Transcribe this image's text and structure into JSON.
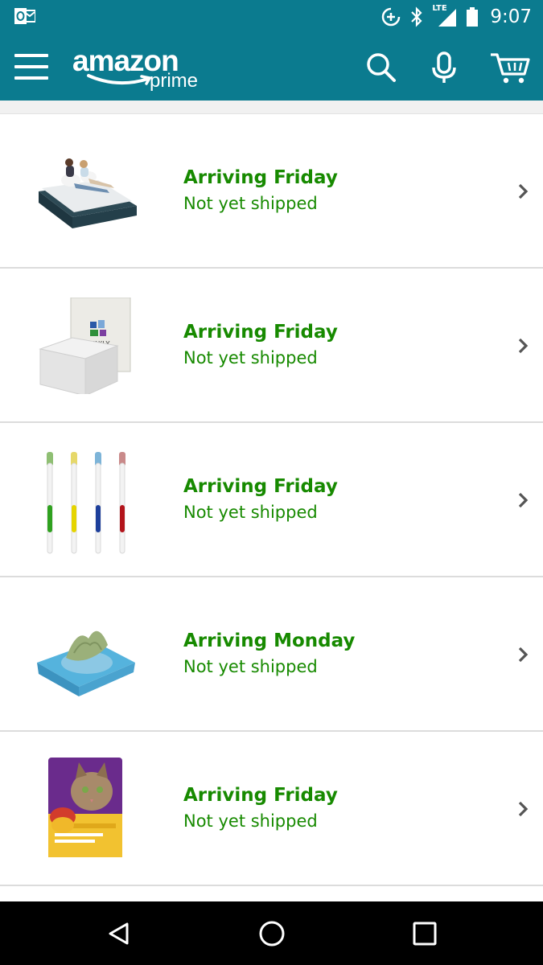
{
  "status_bar": {
    "time": "9:07",
    "network": "LTE",
    "icons": [
      "outlook-icon",
      "data-saver-icon",
      "bluetooth-icon",
      "signal-icon",
      "battery-icon"
    ]
  },
  "app_bar": {
    "logo_text": "amazon",
    "logo_subtext": "prime",
    "icons": [
      "menu-icon",
      "search-icon",
      "microphone-icon",
      "cart-icon"
    ]
  },
  "orders": [
    {
      "title": "Arriving Friday",
      "status": "Not yet shipped",
      "image_icon": "air-mattress-image"
    },
    {
      "title": "Arriving Friday",
      "status": "Not yet shipped",
      "image_icon": "wipes-pack-image"
    },
    {
      "title": "Arriving Friday",
      "status": "Not yet shipped",
      "image_icon": "toothbrushes-image"
    },
    {
      "title": "Arriving Monday",
      "status": "Not yet shipped",
      "image_icon": "wet-wipes-image"
    },
    {
      "title": "Arriving Friday",
      "status": "Not yet shipped",
      "image_icon": "cat-food-bag-image"
    }
  ],
  "colors": {
    "header": "#0b7b8f",
    "delivery_text": "#178a00",
    "nav_bar": "#000000"
  },
  "nav_bar": {
    "buttons": [
      "back-icon",
      "home-icon",
      "recents-icon"
    ]
  }
}
